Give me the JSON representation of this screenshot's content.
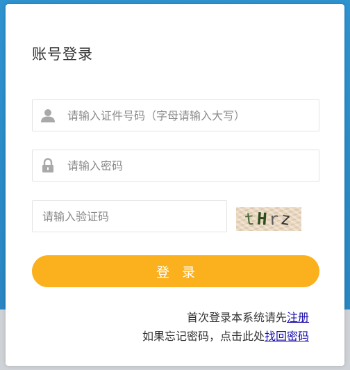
{
  "login": {
    "title": "账号登录",
    "id_field": {
      "placeholder": "请输入证件号码（字母请输入大写）",
      "icon": "user-icon"
    },
    "password_field": {
      "placeholder": "请输入密码",
      "icon": "lock-icon"
    },
    "captcha_field": {
      "placeholder": "请输入验证码"
    },
    "captcha_image": {
      "chars": [
        "t",
        "H",
        "r",
        "z"
      ]
    },
    "submit_label": "登录",
    "register_prompt": "首次登录本系统请先",
    "register_link": "注册",
    "forgot_prompt": "如果忘记密码，点击此处",
    "forgot_link": "找回密码"
  },
  "colors": {
    "background_blue": "#2f93cf",
    "button": "#fbb01d",
    "link": "#1a0dab"
  }
}
